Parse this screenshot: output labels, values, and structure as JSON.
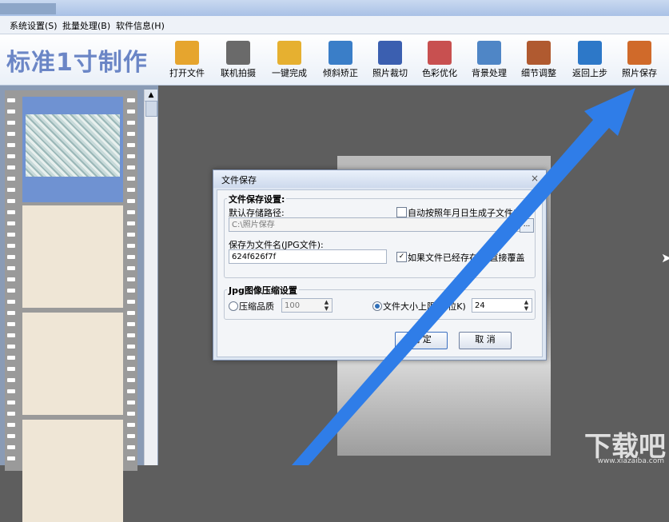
{
  "menu": [
    "系统设置(S)",
    "批量处理(B)",
    "软件信息(H)"
  ],
  "toolbar": {
    "logo": "标准1寸制作",
    "buttons": [
      {
        "label": "打开文件",
        "icon": "folder-icon",
        "color": "#e6a52e"
      },
      {
        "label": "联机拍摄",
        "icon": "camera-icon",
        "color": "#6a6a6a"
      },
      {
        "label": "一键完成",
        "icon": "hand-icon",
        "color": "#e6b030"
      },
      {
        "label": "倾斜矫正",
        "icon": "rotate-icon",
        "color": "#3a7ec8"
      },
      {
        "label": "照片裁切",
        "icon": "crop-icon",
        "color": "#3b5fb0"
      },
      {
        "label": "色彩优化",
        "icon": "color-sliders-icon",
        "color": "#c85050"
      },
      {
        "label": "背景处理",
        "icon": "brush-icon",
        "color": "#4f86c6"
      },
      {
        "label": "细节调整",
        "icon": "histogram-icon",
        "color": "#b05a30"
      },
      {
        "label": "返回上步",
        "icon": "undo-icon",
        "color": "#2d78c8"
      },
      {
        "label": "照片保存",
        "icon": "save-disk-icon",
        "color": "#d06a2a"
      }
    ]
  },
  "dialog": {
    "title": "文件保存",
    "close": "×",
    "group1_label": "文件保存设置:",
    "default_path_label": "默认存储路径:",
    "auto_subfolder_label": "自动按照年月日生成子文件夹",
    "path_value": "C:\\照片保存",
    "filename_label": "保存为文件名(JPG文件):",
    "filename_value": "624f626f7f",
    "overwrite_label": "如果文件已经存在,则直接覆盖",
    "overwrite_check": "✓",
    "browse": "...",
    "group2_label": "Jpg图像压缩设置",
    "quality_label": "压缩品质",
    "quality_value": "100",
    "size_label": "文件大小上限(单位K)",
    "size_value": "24",
    "ok": "确 定",
    "cancel": "取 消"
  },
  "watermark": {
    "text": "下载吧",
    "sub": "www.xiazaiba.com"
  },
  "colors": {
    "accent": "#2f7de8",
    "logo": "#6b86c6"
  }
}
